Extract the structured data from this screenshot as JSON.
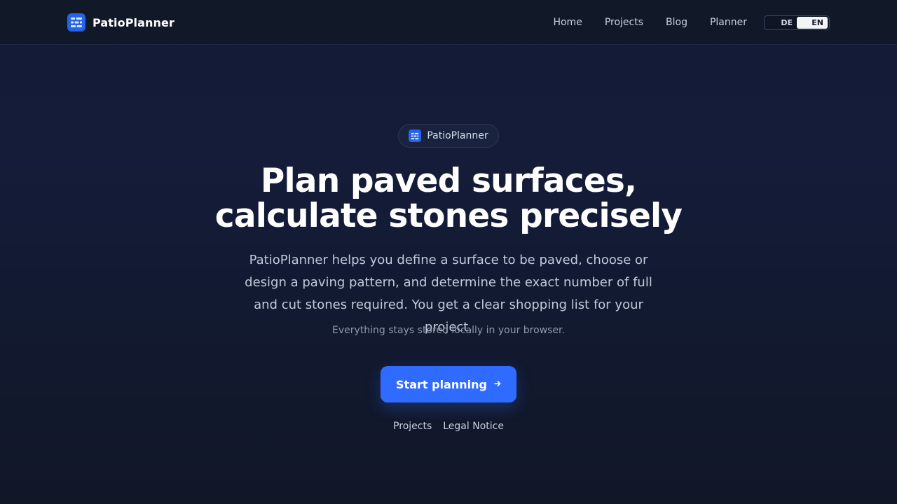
{
  "header": {
    "brand": "PatioPlanner",
    "nav": [
      "Home",
      "Projects",
      "Blog",
      "Planner"
    ],
    "languages": {
      "de": "DE",
      "en": "EN",
      "active": "EN"
    }
  },
  "hero": {
    "badge": "PatioPlanner",
    "title_line1": "Plan paved surfaces,",
    "title_line2": "calculate stones precisely",
    "subtitle": "PatioPlanner helps you define a surface to be paved, choose or design a paving pattern, and determine the exact number of full and cut stones required. You get a clear shopping list for your project.",
    "note": "Everything stays stored locally in your browser.",
    "cta_label": "Start planning",
    "cta_icon": "arrow-right-icon"
  },
  "footer_links": [
    "Projects",
    "Legal Notice"
  ],
  "colors": {
    "accent": "#2f6bff",
    "logo": "#2563eb",
    "header_bg": "#111827"
  }
}
